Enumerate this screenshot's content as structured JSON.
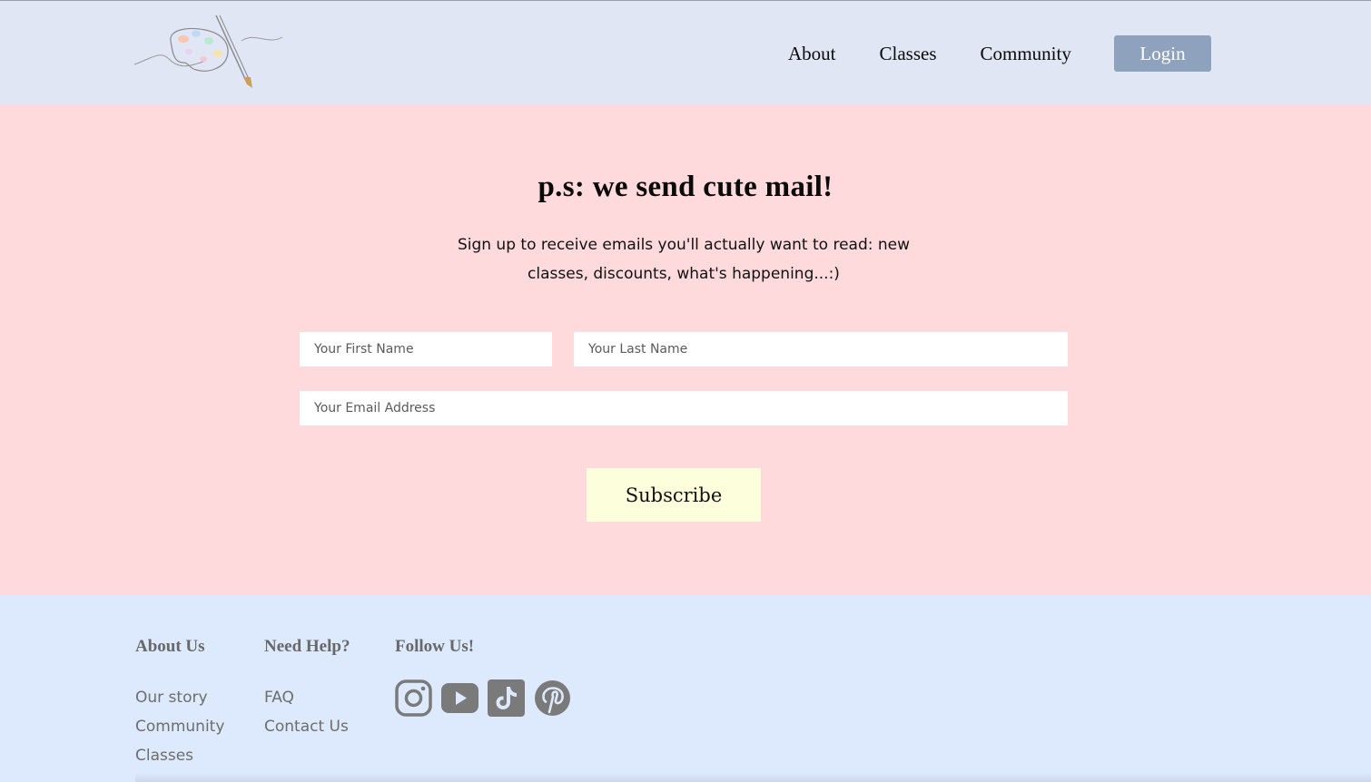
{
  "header": {
    "logo_name": "palette-brush-logo",
    "nav": [
      {
        "label": "About"
      },
      {
        "label": "Classes"
      },
      {
        "label": "Community"
      }
    ],
    "login_label": "Login"
  },
  "signup": {
    "title": "p.s: we send cute mail!",
    "description": "Sign up to receive emails you'll actually want to read: new classes, discounts, what's happening...:)",
    "first_name_placeholder": "Your First Name",
    "last_name_placeholder": "Your Last Name",
    "email_placeholder": "Your Email Address",
    "subscribe_label": "Subscribe"
  },
  "footer": {
    "about": {
      "heading": "About Us",
      "links": [
        "Our story",
        "Community",
        "Classes"
      ]
    },
    "help": {
      "heading": "Need Help?",
      "links": [
        "FAQ",
        "Contact Us"
      ]
    },
    "follow": {
      "heading": "Follow Us!",
      "icons": [
        "instagram-icon",
        "youtube-icon",
        "tiktok-icon",
        "pinterest-icon"
      ]
    }
  },
  "colors": {
    "header_bg": "#e1e6f4",
    "signup_bg": "#fedadc",
    "footer_bg": "#dde9fd",
    "login_bg": "#8ea2bd",
    "subscribe_bg": "#fdffdc",
    "social_icon": "#7a7a7a"
  }
}
